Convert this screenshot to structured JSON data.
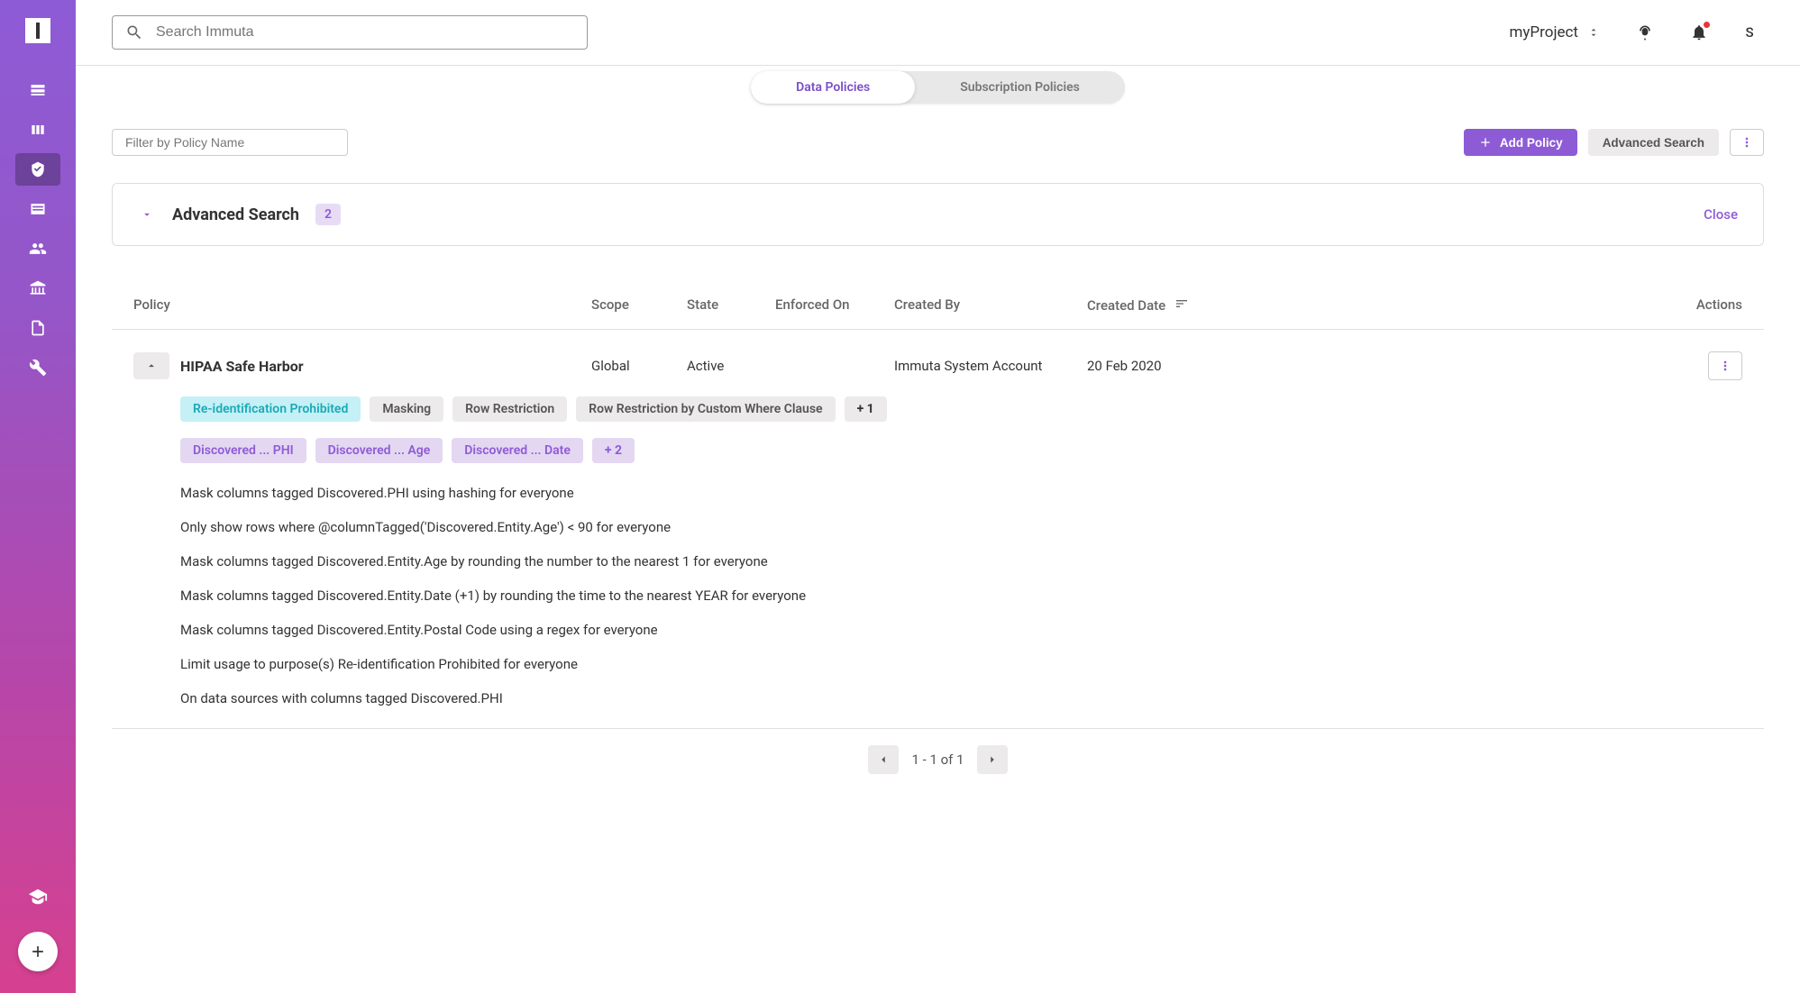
{
  "search": {
    "placeholder": "Search Immuta"
  },
  "topbar": {
    "project": "myProject",
    "avatar_initial": "S"
  },
  "tabs": {
    "data_policies": "Data Policies",
    "subscription_policies": "Subscription Policies"
  },
  "toolbar": {
    "filter_placeholder": "Filter by Policy Name",
    "add_policy": "Add Policy",
    "advanced_search": "Advanced Search"
  },
  "advanced_panel": {
    "title": "Advanced Search",
    "count": "2",
    "close": "Close"
  },
  "columns": {
    "policy": "Policy",
    "scope": "Scope",
    "state": "State",
    "enforced_on": "Enforced On",
    "created_by": "Created By",
    "created_date": "Created Date",
    "actions": "Actions"
  },
  "policy": {
    "name": "HIPAA Safe Harbor",
    "scope": "Global",
    "state": "Active",
    "enforced_on": "",
    "created_by": "Immuta System Account",
    "created_date": "20 Feb 2020",
    "tags_row1": [
      {
        "label": "Re-identification Prohibited",
        "style": "cyan"
      },
      {
        "label": "Masking",
        "style": "gray"
      },
      {
        "label": "Row Restriction",
        "style": "gray"
      },
      {
        "label": "Row Restriction by Custom Where Clause",
        "style": "gray"
      },
      {
        "label": "+ 1",
        "style": "gray-bold"
      }
    ],
    "tags_row2": [
      {
        "label": "Discovered ... PHI",
        "style": "purple"
      },
      {
        "label": "Discovered ... Age",
        "style": "purple"
      },
      {
        "label": "Discovered ... Date",
        "style": "purple"
      },
      {
        "label": "+ 2",
        "style": "purple-bold"
      }
    ],
    "rules": [
      "Mask columns tagged Discovered.PHI using hashing for everyone",
      "Only show rows where @columnTagged('Discovered.Entity.Age') < 90 for everyone",
      "Mask columns tagged Discovered.Entity.Age by rounding the number to the nearest 1 for everyone",
      "Mask columns tagged Discovered.Entity.Date (+1) by rounding the time to the nearest YEAR for everyone",
      "Mask columns tagged Discovered.Entity.Postal Code using a regex for everyone",
      "Limit usage to purpose(s) Re-identification Prohibited for everyone",
      "On data sources with columns tagged Discovered.PHI"
    ]
  },
  "pagination": {
    "label": "1 - 1 of 1"
  }
}
